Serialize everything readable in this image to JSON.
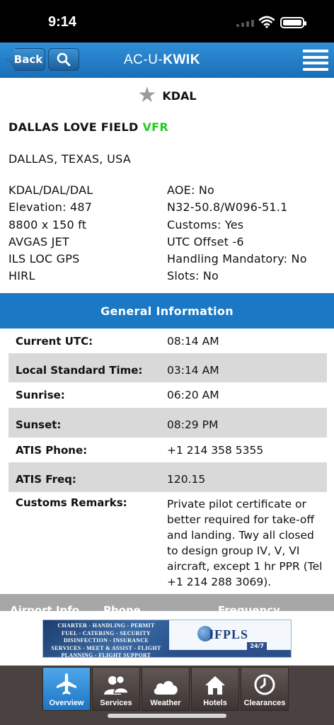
{
  "status": {
    "time": "9:14"
  },
  "nav": {
    "back_label": "Back",
    "logo_prefix": "AC-U-",
    "logo_bold": "KWIK",
    "logo_tick": "´"
  },
  "airport": {
    "icao": "KDAL",
    "name": "DALLAS LOVE FIELD",
    "flight_category": "VFR",
    "flight_category_color": "#22cc22",
    "location": "DALLAS, TEXAS, USA",
    "details_left": [
      "KDAL/DAL/DAL",
      "Elevation: 487",
      "8800 x 150 ft",
      "AVGAS JET",
      "ILS LOC GPS",
      "HIRL"
    ],
    "details_right": [
      "AOE: No",
      "N32-50.8/W096-51.1",
      "Customs: Yes",
      "UTC Offset -6",
      "Handling Mandatory: No",
      "Slots: No"
    ]
  },
  "general": {
    "title": "General Information",
    "rows": [
      {
        "label": "Current UTC:",
        "value": "08:14 AM"
      },
      {
        "label": "Local Standard Time:",
        "value": "03:14 AM"
      },
      {
        "label": "Sunrise:",
        "value": "06:20 AM"
      },
      {
        "label": "Sunset:",
        "value": "08:29 PM"
      },
      {
        "label": "ATIS Phone:",
        "value": "+1 214 358 5355"
      },
      {
        "label": "ATIS Freq:",
        "value": "120.15"
      },
      {
        "label": "Customs Remarks:",
        "value": "Private pilot certificate or better required for take-off and landing. Twy all closed to design group IV, V, VI aircraft, except 1 hr PPR (Tel +1 214 288 3069)."
      }
    ]
  },
  "next_section": {
    "col1": "Airport Info",
    "col2": "Phone",
    "col3": "Frequency"
  },
  "ad": {
    "lines": [
      "CHARTER - HANDLING - PERMIT",
      "FUEL - CATERING - SECURITY",
      "DISINFECTION - INSURANCE",
      "SERVICES - MEET & ASSIST - FLIGHT",
      "PLANNING - FLIGHT SUPPORT"
    ],
    "brand": "IFPLS",
    "badge": "24/7"
  },
  "tabs": [
    {
      "label": "Overview",
      "icon": "airplane-icon",
      "active": true
    },
    {
      "label": "Services",
      "icon": "people-icon",
      "active": false
    },
    {
      "label": "Weather",
      "icon": "cloud-icon",
      "active": false
    },
    {
      "label": "Hotels",
      "icon": "house-icon",
      "active": false
    },
    {
      "label": "Clearances",
      "icon": "clock-icon",
      "active": false
    }
  ]
}
